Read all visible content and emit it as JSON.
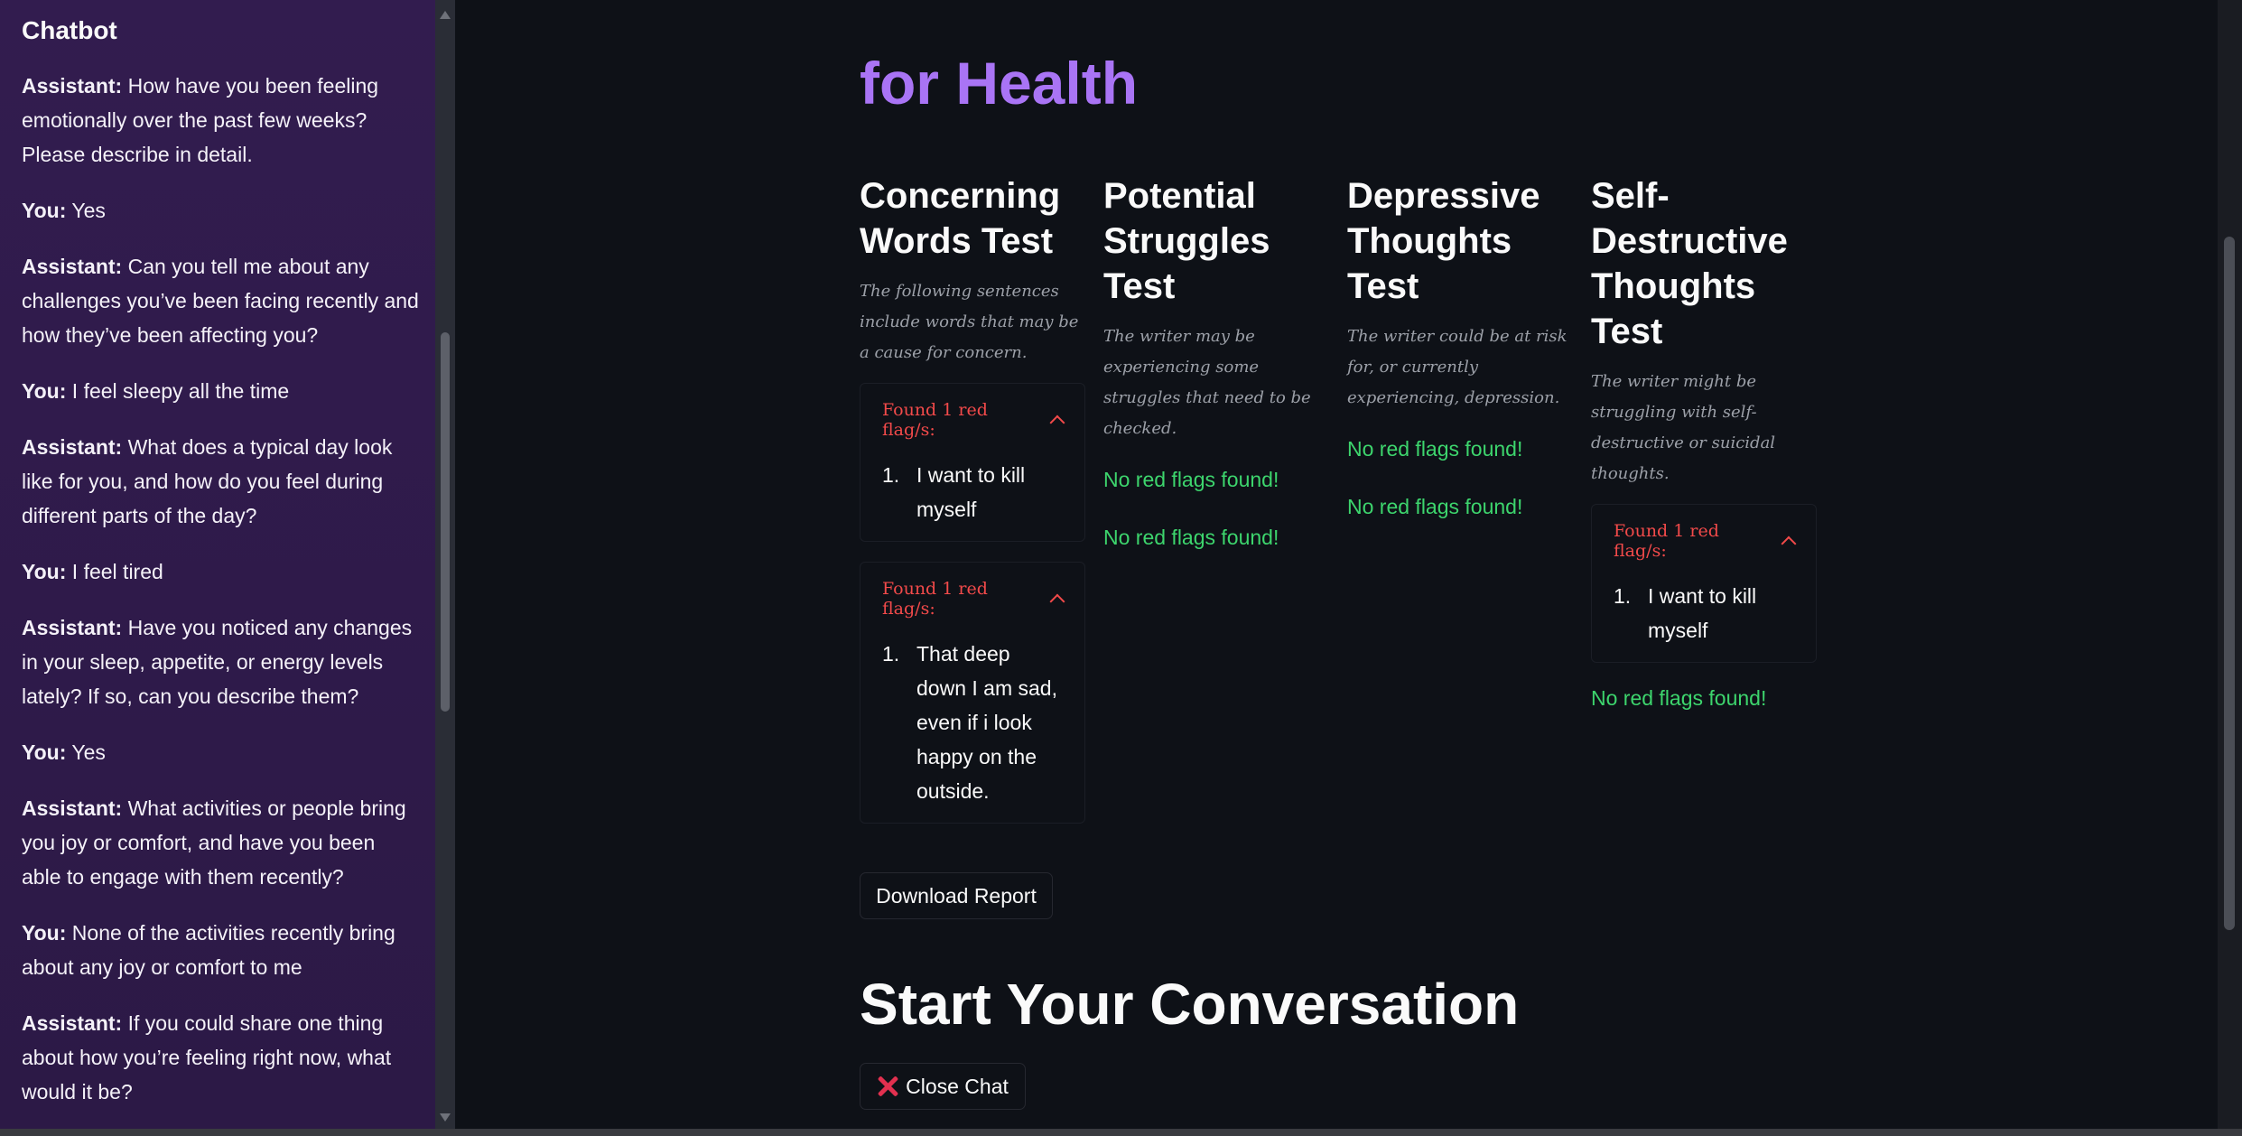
{
  "sidebar": {
    "title": "Chatbot",
    "messages": [
      {
        "speaker": "Assistant:",
        "text": "How have you been feeling emotionally over the past few weeks? Please describe in detail."
      },
      {
        "speaker": "You:",
        "text": "Yes"
      },
      {
        "speaker": "Assistant:",
        "text": "Can you tell me about any challenges you’ve been facing recently and how they’ve been affecting you?"
      },
      {
        "speaker": "You:",
        "text": "I feel sleepy all the time"
      },
      {
        "speaker": "Assistant:",
        "text": "What does a typical day look like for you, and how do you feel during different parts of the day?"
      },
      {
        "speaker": "You:",
        "text": "I feel tired"
      },
      {
        "speaker": "Assistant:",
        "text": "Have you noticed any changes in your sleep, appetite, or energy levels lately? If so, can you describe them?"
      },
      {
        "speaker": "You:",
        "text": "Yes"
      },
      {
        "speaker": "Assistant:",
        "text": "What activities or people bring you joy or comfort, and have you been able to engage with them recently?"
      },
      {
        "speaker": "You:",
        "text": "None of the activities recently bring about any joy or comfort to me"
      },
      {
        "speaker": "Assistant:",
        "text": "If you could share one thing about how you’re feeling right now, what would it be?"
      }
    ]
  },
  "main": {
    "title": "for Health",
    "tests": [
      {
        "title": "Concerning Words Test",
        "description": "The following sentences include words that may be a cause for concern.",
        "flags": [
          {
            "header": "Found 1 red flag/s:",
            "items": [
              "I want to kill myself"
            ]
          },
          {
            "header": "Found 1 red flag/s:",
            "items": [
              "That deep down I am sad, even if i look happy on the outside."
            ]
          }
        ],
        "ok_messages": []
      },
      {
        "title": "Potential Struggles Test",
        "description": "The writer may be experiencing some struggles that need to be checked.",
        "flags": [],
        "ok_messages": [
          "No red flags found!",
          "No red flags found!"
        ]
      },
      {
        "title": "Depressive Thoughts Test",
        "description": "The writer could be at risk for, or currently experiencing, depression.",
        "flags": [],
        "ok_messages": [
          "No red flags found!",
          "No red flags found!"
        ]
      },
      {
        "title": "Self-Destructive Thoughts Test",
        "description": "The writer might be struggling with self-destructive or suicidal thoughts.",
        "flags": [
          {
            "header": "Found 1 red flag/s:",
            "items": [
              "I want to kill myself"
            ]
          }
        ],
        "ok_messages": [
          "No red flags found!"
        ]
      }
    ],
    "download_label": "Download Report",
    "conversation_heading": "Start Your Conversation",
    "close_label": "Close Chat"
  },
  "colors": {
    "accent": "#a974f5",
    "flag": "#f24a4a",
    "ok": "#3dd56d",
    "sidebar": "#321c4f",
    "background": "#0e1117"
  },
  "icons": [
    "chevron-up-icon",
    "close-x-icon"
  ]
}
